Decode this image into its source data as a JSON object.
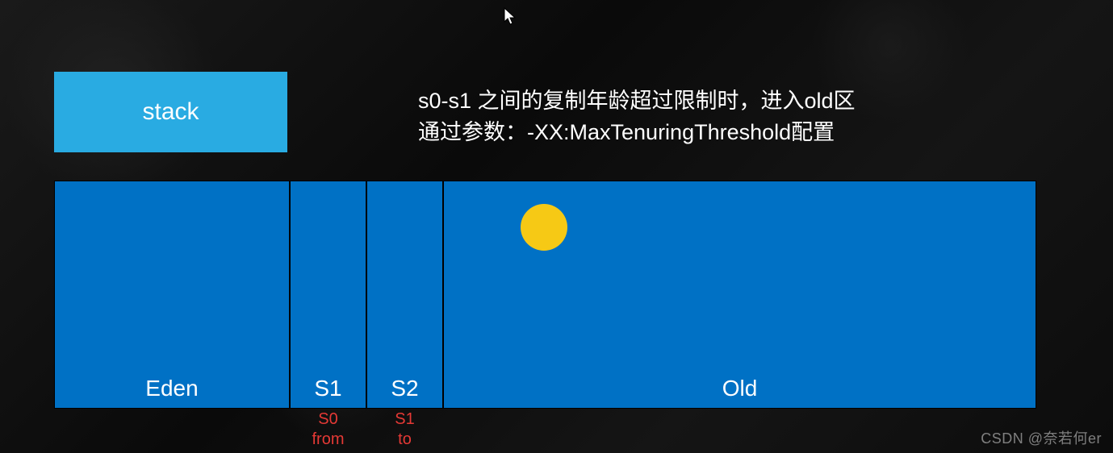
{
  "stack": {
    "label": "stack"
  },
  "description": {
    "line1": "s0-s1 之间的复制年龄超过限制时，进入old区",
    "line2": "通过参数：-XX:MaxTenuringThreshold配置"
  },
  "heap": {
    "eden": {
      "label": "Eden"
    },
    "s1": {
      "label": "S1",
      "sub_top": "S0",
      "sub_bottom": "from"
    },
    "s2": {
      "label": "S2",
      "sub_top": "S1",
      "sub_bottom": "to"
    },
    "old": {
      "label": "Old",
      "object_color": "#f6c915"
    }
  },
  "watermark": "CSDN @奈若何er"
}
